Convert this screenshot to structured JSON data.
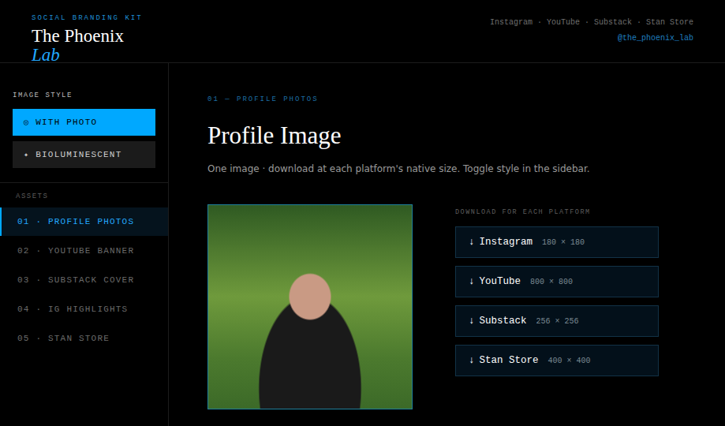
{
  "header": {
    "eyebrow": "SOCIAL BRANDING KIT",
    "title": "The Phoenix",
    "title_accent": "Lab",
    "platforms": "Instagram · YouTube · Substack · Stan Store",
    "handle": "@the_phoenix_lab"
  },
  "sidebar": {
    "style_label": "IMAGE STYLE",
    "styles": [
      {
        "icon": "◎",
        "label": "WITH PHOTO",
        "selected": true
      },
      {
        "icon": "✦",
        "label": "BIOLUMINESCENT",
        "selected": false
      }
    ],
    "assets_label": "ASSETS",
    "items": [
      {
        "label": "01 · PROFILE PHOTOS",
        "selected": true
      },
      {
        "label": "02 · YOUTUBE BANNER",
        "selected": false
      },
      {
        "label": "03 · SUBSTACK COVER",
        "selected": false
      },
      {
        "label": "04 · IG HIGHLIGHTS",
        "selected": false
      },
      {
        "label": "05 · STAN STORE",
        "selected": false
      }
    ]
  },
  "section": {
    "eyebrow": "01 — PROFILE PHOTOS",
    "title": "Profile Image",
    "subtitle": "One image · download at each platform's native size. Toggle style in the sidebar."
  },
  "downloads": {
    "label": "DOWNLOAD FOR EACH PLATFORM",
    "buttons": [
      {
        "icon": "↓",
        "label": "Instagram",
        "size": "180 × 180"
      },
      {
        "icon": "↓",
        "label": "YouTube",
        "size": "800 × 800"
      },
      {
        "icon": "↓",
        "label": "Substack",
        "size": "256 × 256"
      },
      {
        "icon": "↓",
        "label": "Stan Store",
        "size": "400 × 400"
      }
    ]
  }
}
